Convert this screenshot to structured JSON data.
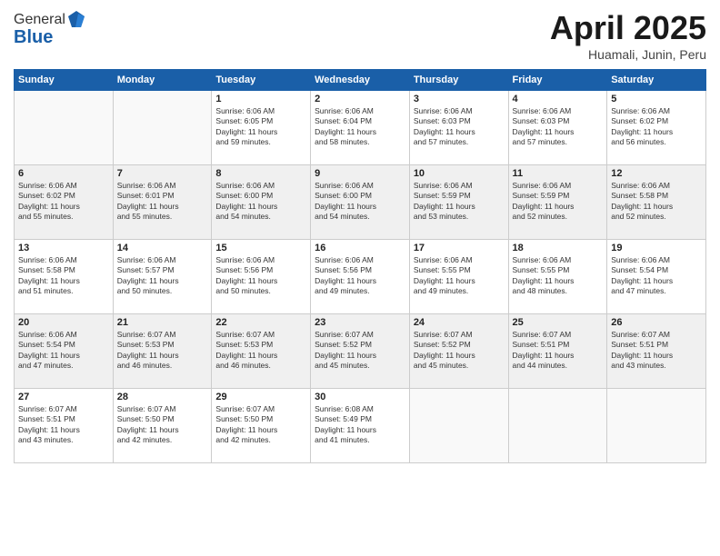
{
  "header": {
    "logo_general": "General",
    "logo_blue": "Blue",
    "month_title": "April 2025",
    "location": "Huamali, Junin, Peru"
  },
  "weekdays": [
    "Sunday",
    "Monday",
    "Tuesday",
    "Wednesday",
    "Thursday",
    "Friday",
    "Saturday"
  ],
  "weeks": [
    [
      {
        "day": "",
        "text": ""
      },
      {
        "day": "",
        "text": ""
      },
      {
        "day": "1",
        "text": "Sunrise: 6:06 AM\nSunset: 6:05 PM\nDaylight: 11 hours\nand 59 minutes."
      },
      {
        "day": "2",
        "text": "Sunrise: 6:06 AM\nSunset: 6:04 PM\nDaylight: 11 hours\nand 58 minutes."
      },
      {
        "day": "3",
        "text": "Sunrise: 6:06 AM\nSunset: 6:03 PM\nDaylight: 11 hours\nand 57 minutes."
      },
      {
        "day": "4",
        "text": "Sunrise: 6:06 AM\nSunset: 6:03 PM\nDaylight: 11 hours\nand 57 minutes."
      },
      {
        "day": "5",
        "text": "Sunrise: 6:06 AM\nSunset: 6:02 PM\nDaylight: 11 hours\nand 56 minutes."
      }
    ],
    [
      {
        "day": "6",
        "text": "Sunrise: 6:06 AM\nSunset: 6:02 PM\nDaylight: 11 hours\nand 55 minutes."
      },
      {
        "day": "7",
        "text": "Sunrise: 6:06 AM\nSunset: 6:01 PM\nDaylight: 11 hours\nand 55 minutes."
      },
      {
        "day": "8",
        "text": "Sunrise: 6:06 AM\nSunset: 6:00 PM\nDaylight: 11 hours\nand 54 minutes."
      },
      {
        "day": "9",
        "text": "Sunrise: 6:06 AM\nSunset: 6:00 PM\nDaylight: 11 hours\nand 54 minutes."
      },
      {
        "day": "10",
        "text": "Sunrise: 6:06 AM\nSunset: 5:59 PM\nDaylight: 11 hours\nand 53 minutes."
      },
      {
        "day": "11",
        "text": "Sunrise: 6:06 AM\nSunset: 5:59 PM\nDaylight: 11 hours\nand 52 minutes."
      },
      {
        "day": "12",
        "text": "Sunrise: 6:06 AM\nSunset: 5:58 PM\nDaylight: 11 hours\nand 52 minutes."
      }
    ],
    [
      {
        "day": "13",
        "text": "Sunrise: 6:06 AM\nSunset: 5:58 PM\nDaylight: 11 hours\nand 51 minutes."
      },
      {
        "day": "14",
        "text": "Sunrise: 6:06 AM\nSunset: 5:57 PM\nDaylight: 11 hours\nand 50 minutes."
      },
      {
        "day": "15",
        "text": "Sunrise: 6:06 AM\nSunset: 5:56 PM\nDaylight: 11 hours\nand 50 minutes."
      },
      {
        "day": "16",
        "text": "Sunrise: 6:06 AM\nSunset: 5:56 PM\nDaylight: 11 hours\nand 49 minutes."
      },
      {
        "day": "17",
        "text": "Sunrise: 6:06 AM\nSunset: 5:55 PM\nDaylight: 11 hours\nand 49 minutes."
      },
      {
        "day": "18",
        "text": "Sunrise: 6:06 AM\nSunset: 5:55 PM\nDaylight: 11 hours\nand 48 minutes."
      },
      {
        "day": "19",
        "text": "Sunrise: 6:06 AM\nSunset: 5:54 PM\nDaylight: 11 hours\nand 47 minutes."
      }
    ],
    [
      {
        "day": "20",
        "text": "Sunrise: 6:06 AM\nSunset: 5:54 PM\nDaylight: 11 hours\nand 47 minutes."
      },
      {
        "day": "21",
        "text": "Sunrise: 6:07 AM\nSunset: 5:53 PM\nDaylight: 11 hours\nand 46 minutes."
      },
      {
        "day": "22",
        "text": "Sunrise: 6:07 AM\nSunset: 5:53 PM\nDaylight: 11 hours\nand 46 minutes."
      },
      {
        "day": "23",
        "text": "Sunrise: 6:07 AM\nSunset: 5:52 PM\nDaylight: 11 hours\nand 45 minutes."
      },
      {
        "day": "24",
        "text": "Sunrise: 6:07 AM\nSunset: 5:52 PM\nDaylight: 11 hours\nand 45 minutes."
      },
      {
        "day": "25",
        "text": "Sunrise: 6:07 AM\nSunset: 5:51 PM\nDaylight: 11 hours\nand 44 minutes."
      },
      {
        "day": "26",
        "text": "Sunrise: 6:07 AM\nSunset: 5:51 PM\nDaylight: 11 hours\nand 43 minutes."
      }
    ],
    [
      {
        "day": "27",
        "text": "Sunrise: 6:07 AM\nSunset: 5:51 PM\nDaylight: 11 hours\nand 43 minutes."
      },
      {
        "day": "28",
        "text": "Sunrise: 6:07 AM\nSunset: 5:50 PM\nDaylight: 11 hours\nand 42 minutes."
      },
      {
        "day": "29",
        "text": "Sunrise: 6:07 AM\nSunset: 5:50 PM\nDaylight: 11 hours\nand 42 minutes."
      },
      {
        "day": "30",
        "text": "Sunrise: 6:08 AM\nSunset: 5:49 PM\nDaylight: 11 hours\nand 41 minutes."
      },
      {
        "day": "",
        "text": ""
      },
      {
        "day": "",
        "text": ""
      },
      {
        "day": "",
        "text": ""
      }
    ]
  ]
}
